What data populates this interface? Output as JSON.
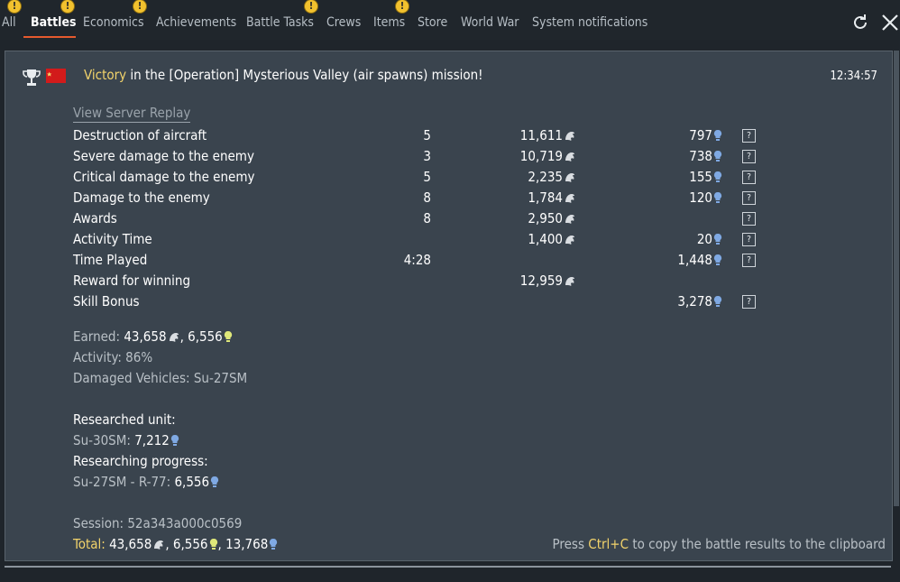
{
  "tabs": [
    {
      "label": "All",
      "alert": true
    },
    {
      "label": "Battles",
      "alert": true,
      "active": true
    },
    {
      "label": "Economics",
      "alert": true
    },
    {
      "label": "Achievements",
      "alert": false
    },
    {
      "label": "Battle Tasks",
      "alert": true
    },
    {
      "label": "Crews",
      "alert": false
    },
    {
      "label": "Items",
      "alert": true
    },
    {
      "label": "Store",
      "alert": false
    },
    {
      "label": "World War",
      "alert": false
    },
    {
      "label": "System notifications",
      "alert": false
    }
  ],
  "alert_glyph": "!",
  "icons": {
    "refresh": "refresh-icon",
    "close": "close-icon",
    "trophy": "trophy-icon",
    "flag": "ussr-flag-icon",
    "silver": "silver-lions-icon",
    "rp": "research-points-icon",
    "free_rp": "free-research-points-icon",
    "help": "help-icon"
  },
  "colors": {
    "accent": "#e55a2e",
    "highlight": "#f2d36b",
    "panel": "#3a444e",
    "rp_blue": "#7fa9e3",
    "free_rp": "#dfe87a"
  },
  "message": {
    "victory": "Victory",
    "text": " in the [Operation] Mysterious Valley (air spawns) mission!",
    "time": "12:34:57",
    "replay": "View Server Replay"
  },
  "rows": [
    {
      "label": "Destruction of aircraft",
      "count": "5",
      "silver": "11,611",
      "rp": "797",
      "help": true
    },
    {
      "label": "Severe damage to the enemy",
      "count": "3",
      "silver": "10,719",
      "rp": "738",
      "help": true
    },
    {
      "label": "Critical damage to the enemy",
      "count": "5",
      "silver": "2,235",
      "rp": "155",
      "help": true
    },
    {
      "label": "Damage to the enemy",
      "count": "8",
      "silver": "1,784",
      "rp": "120",
      "help": true
    },
    {
      "label": "Awards",
      "count": "8",
      "silver": "2,950",
      "rp": "",
      "help": true
    },
    {
      "label": "Activity Time",
      "count": "",
      "silver": "1,400",
      "rp": "20",
      "help": true
    },
    {
      "label": "Time Played",
      "count": "4:28",
      "silver": "",
      "rp": "1,448",
      "help": true
    },
    {
      "label": "Reward for winning",
      "count": "",
      "silver": "12,959",
      "rp": "",
      "help": false
    },
    {
      "label": "Skill Bonus",
      "count": "",
      "silver": "",
      "rp": "3,278",
      "help": true
    }
  ],
  "help_glyph": "?",
  "summary": {
    "earned_label": "Earned: ",
    "earned_silver": "43,658",
    "earned_free": "6,556",
    "activity": "Activity: 86%",
    "damaged": "Damaged Vehicles: Su-27SM",
    "researched_label": "Researched unit:",
    "researched_unit": "Su-30SM: ",
    "researched_rp": "7,212",
    "progress_label": "Researching progress:",
    "progress_item": "Su-27SM - R-77: ",
    "progress_rp": "6,556",
    "session": "Session: 52a343a000c0569",
    "total_label": "Total: ",
    "total_silver": "43,658",
    "total_free": "6,556",
    "total_rp": "13,768",
    "sep": ", "
  },
  "hint": {
    "pre": "Press ",
    "keys": "Ctrl+C",
    "post": " to copy the battle results to the clipboard"
  }
}
